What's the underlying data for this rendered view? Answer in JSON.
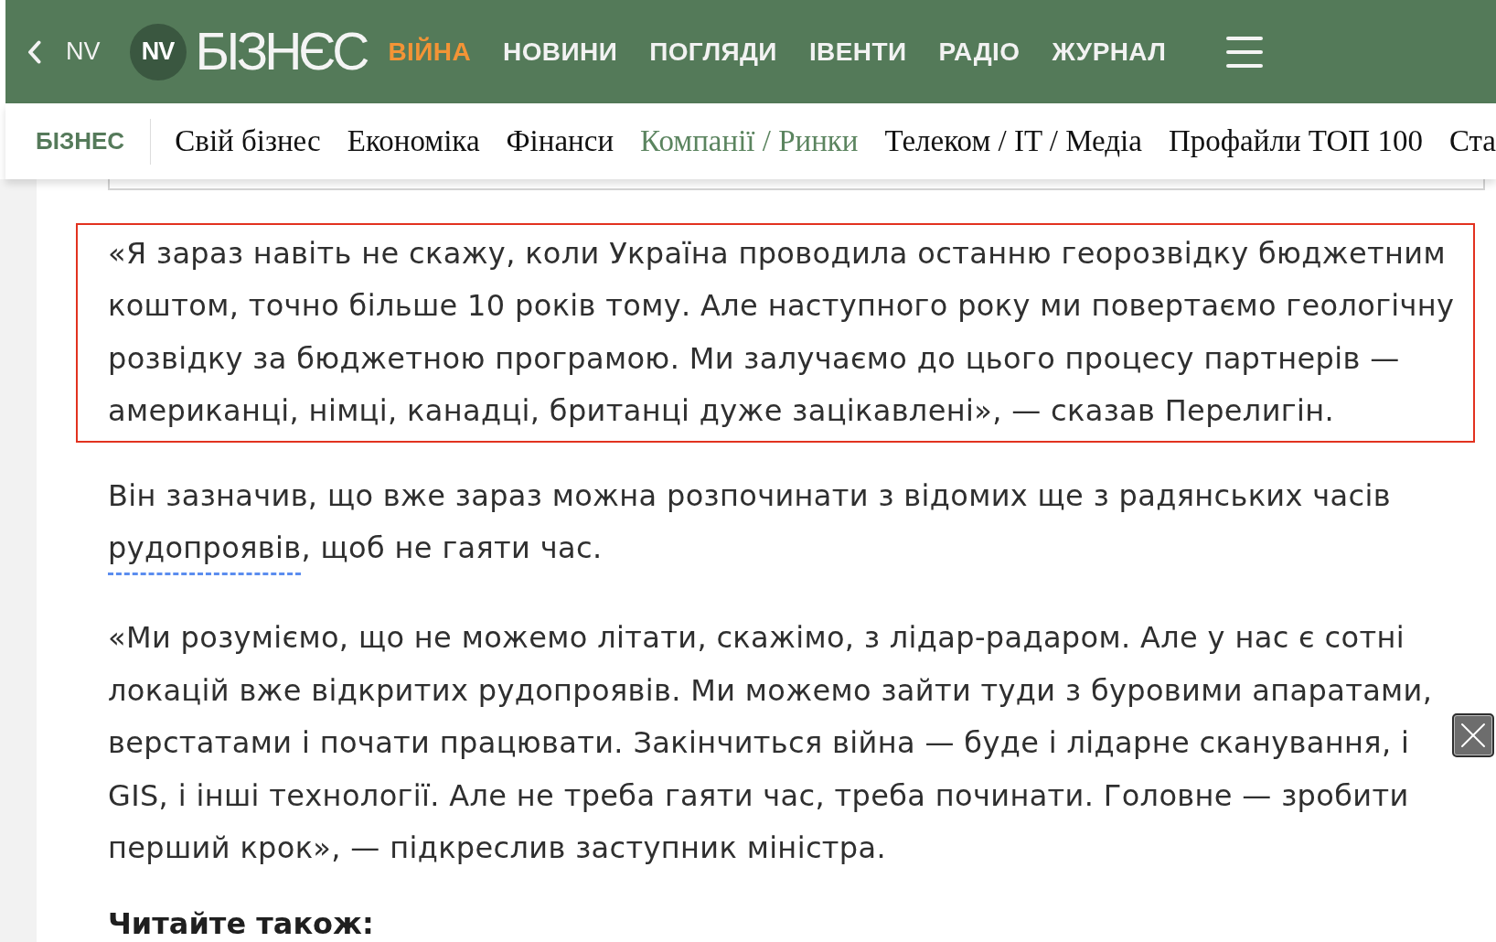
{
  "top_bar": {
    "back_label": "NV",
    "logo": {
      "badge": "NV",
      "wordmark": "БІЗНЄС"
    },
    "nav": [
      {
        "label": "ВІЙНА",
        "accent": true
      },
      {
        "label": "НОВИНИ",
        "accent": false
      },
      {
        "label": "ПОГЛЯДИ",
        "accent": false
      },
      {
        "label": "ІВЕНТИ",
        "accent": false
      },
      {
        "label": "РАДІО",
        "accent": false
      },
      {
        "label": "ЖУРНАЛ",
        "accent": false
      }
    ]
  },
  "section_bar": {
    "section": "БІЗНЕС",
    "items": [
      {
        "label": "Свій бізнес",
        "selected": false
      },
      {
        "label": "Економіка",
        "selected": false
      },
      {
        "label": "Фінанси",
        "selected": false
      },
      {
        "label": "Компанії / Ринки",
        "selected": true
      },
      {
        "label": "Телеком / IT / Медіа",
        "selected": false
      },
      {
        "label": "Профайли ТОП 100",
        "selected": false
      },
      {
        "label": "Ста",
        "selected": false
      }
    ]
  },
  "article": {
    "paragraphs": [
      {
        "highlighted": true,
        "runs": [
          {
            "kind": "text",
            "text": "«Я зараз навіть не скажу, коли Україна проводила останню георозвідку бюджетним\nкоштом, точно більше 10 років тому. Але наступного року ми повертаємо геологічну\nрозвідку за бюджетною програмою. Ми залучаємо до цього процесу партнерів —\nамериканці, німці, канадці, британці дуже зацікавлені», — сказав Перелигін."
          }
        ]
      },
      {
        "highlighted": false,
        "runs": [
          {
            "kind": "text",
            "text": "Він зазначив, що вже зараз можна розпочинати з відомих ще з радянських часів\n"
          },
          {
            "kind": "link",
            "text": "рудопроявів"
          },
          {
            "kind": "text",
            "text": ", щоб не гаяти час."
          }
        ]
      },
      {
        "highlighted": false,
        "runs": [
          {
            "kind": "text",
            "text": "«Ми розуміємо, що не можемо літати, скажімо, з лідар-радаром. Але у нас є сотні\nлокацій вже відкритих рудопроявів. Ми можемо зайти туди з буровими апаратами,\nверстатами і почати працювати. Закінчиться війна — буде і лідарне сканування, і\nGIS, і інші технології. Але не треба гаяти час, треба починати. Головне — зробити\nперший крок», — підкреслив заступник міністра."
          }
        ]
      }
    ],
    "read_also_heading": "Читайте також:"
  }
}
